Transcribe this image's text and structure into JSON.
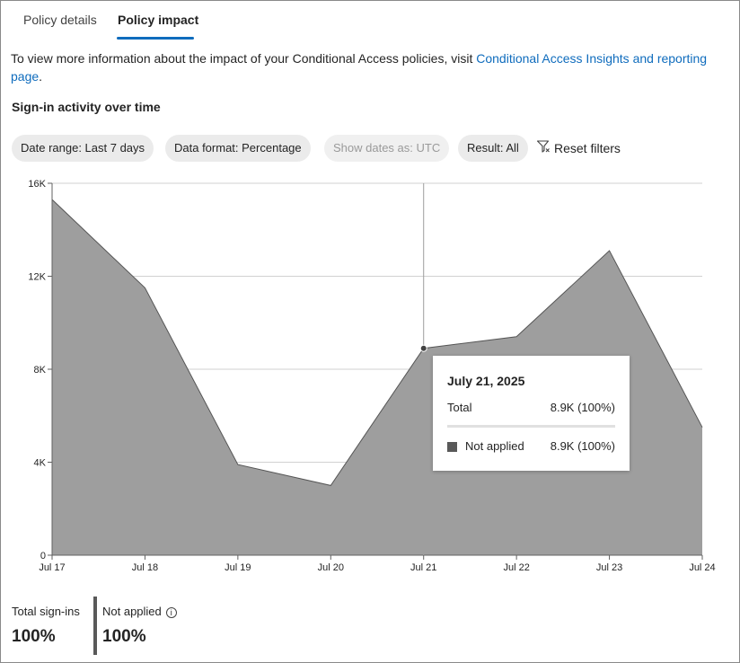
{
  "tabs": [
    {
      "label": "Policy details",
      "selected": false
    },
    {
      "label": "Policy impact",
      "selected": true
    }
  ],
  "info": {
    "text": "To view more information about the impact of your Conditional Access policies, visit ",
    "link": "Conditional Access Insights and reporting page",
    "suffix": "."
  },
  "section_title": "Sign-in activity over time",
  "filters": {
    "date_range": "Date range: Last 7 days",
    "data_format": "Data format: Percentage",
    "show_dates": "Show dates as: UTC",
    "result": "Result: All",
    "reset": "Reset filters"
  },
  "chart_data": {
    "type": "area",
    "x": [
      "Jul 17",
      "Jul 18",
      "Jul 19",
      "Jul 20",
      "Jul 21",
      "Jul 22",
      "Jul 23",
      "Jul 24"
    ],
    "series": [
      {
        "name": "Not applied",
        "values": [
          15300,
          11500,
          3900,
          3000,
          8900,
          9400,
          13100,
          5500
        ],
        "color": "#9e9e9e"
      }
    ],
    "y_ticks": [
      0,
      4000,
      8000,
      12000,
      16000
    ],
    "y_tick_labels": [
      "0",
      "4K",
      "8K",
      "12K",
      "16K"
    ],
    "ylim": [
      0,
      16000
    ],
    "grid": true,
    "hover_index": 4
  },
  "tooltip": {
    "date": "July 21, 2025",
    "total_label": "Total",
    "total_value": "8.9K (100%)",
    "series_label": "Not applied",
    "series_value": "8.9K (100%)",
    "series_color": "#595959"
  },
  "summary": {
    "total_label": "Total sign-ins",
    "total_value": "100%",
    "not_applied_label": "Not applied",
    "not_applied_value": "100%"
  }
}
